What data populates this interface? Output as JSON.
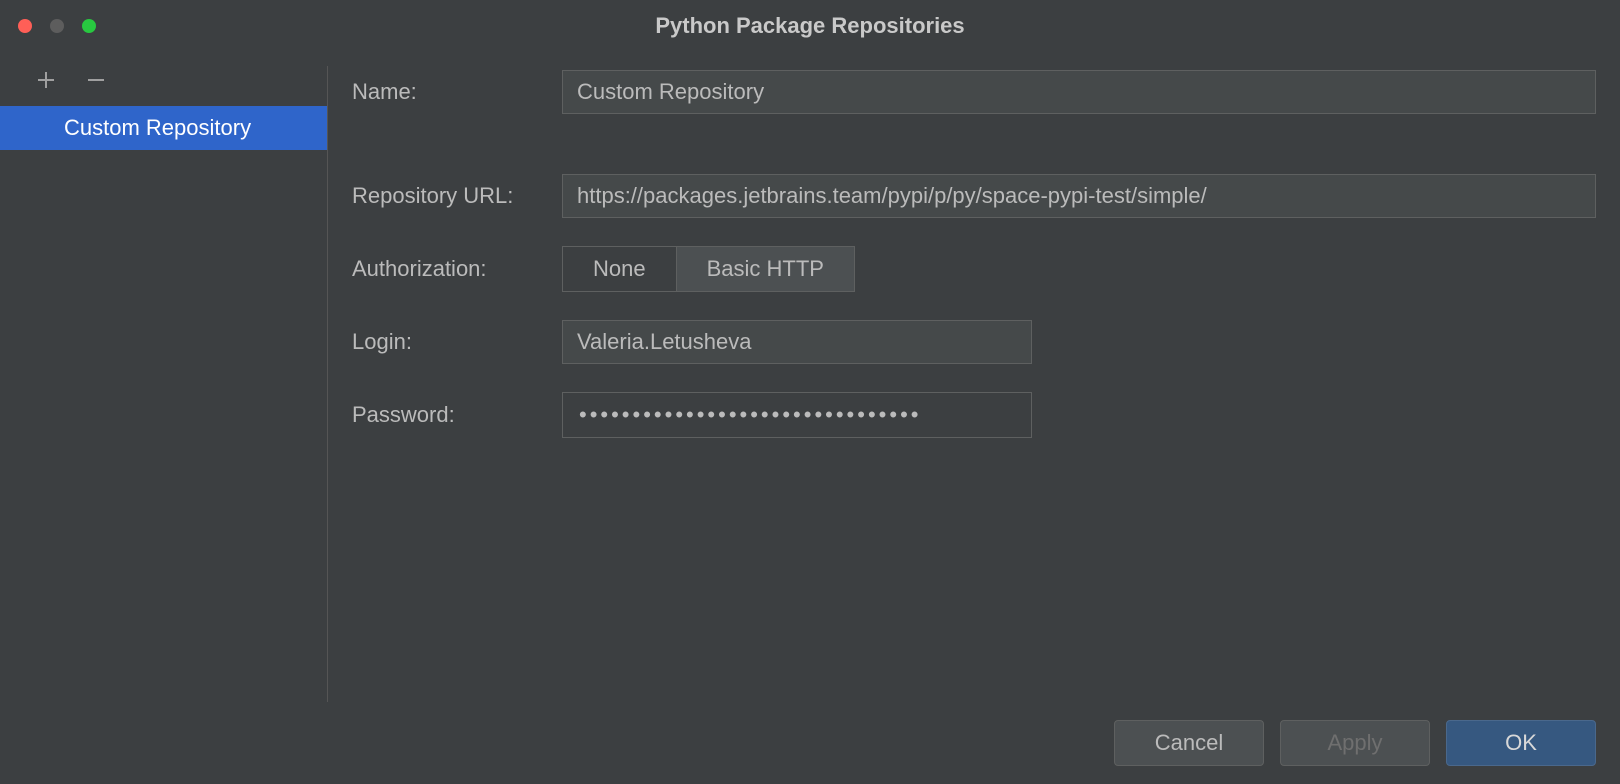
{
  "window": {
    "title": "Python Package Repositories"
  },
  "sidebar": {
    "items": [
      {
        "label": "Custom Repository"
      }
    ]
  },
  "form": {
    "name_label": "Name:",
    "name_value": "Custom Repository",
    "url_label": "Repository URL:",
    "url_value": "https://packages.jetbrains.team/pypi/p/py/space-pypi-test/simple/",
    "auth_label": "Authorization:",
    "auth_options": {
      "none": "None",
      "basic": "Basic HTTP"
    },
    "auth_selected": "basic",
    "login_label": "Login:",
    "login_value": "Valeria.Letusheva",
    "password_label": "Password:",
    "password_mask": "••••••••••••••••••••••••••••••••"
  },
  "footer": {
    "cancel": "Cancel",
    "apply": "Apply",
    "ok": "OK"
  }
}
